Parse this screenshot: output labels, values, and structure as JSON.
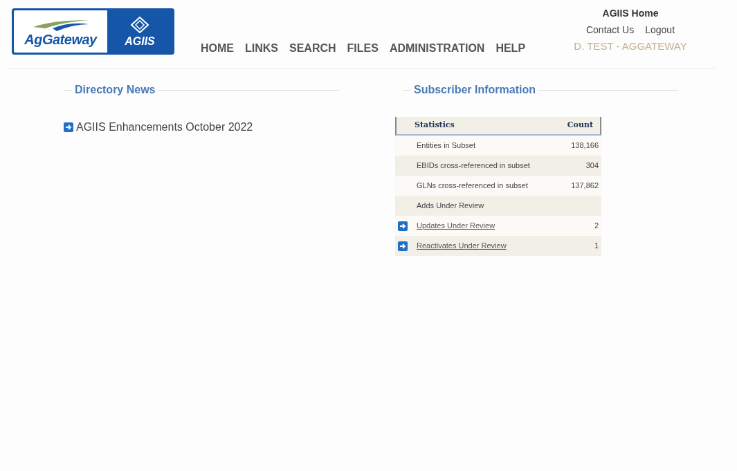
{
  "logo": {
    "left_text": "AgGateway",
    "right_text": "AGIIS"
  },
  "nav": [
    "HOME",
    "LINKS",
    "SEARCH",
    "FILES",
    "ADMINISTRATION",
    "HELP"
  ],
  "user_panel": {
    "title": "AGIIS Home",
    "links": [
      "Contact Us",
      "Logout"
    ],
    "user": "D. TEST - AGGATEWAY"
  },
  "directory_news": {
    "title": "Directory News",
    "items": [
      "AGIIS Enhancements October 2022"
    ]
  },
  "subscriber_information": {
    "title": "Subscriber Information",
    "table": {
      "columns": [
        "Statistics",
        "Count"
      ],
      "rows": [
        {
          "kind": "plain",
          "label": "Entities in Subset",
          "count": "138,166"
        },
        {
          "kind": "plain",
          "label": "EBIDs cross-referenced in subset",
          "count": "304"
        },
        {
          "kind": "plain",
          "label": "GLNs cross-referenced in subset",
          "count": "137,862"
        },
        {
          "kind": "plain",
          "label": "Adds Under Review"
        },
        {
          "kind": "link",
          "label": "Updates Under Review",
          "count": "2"
        },
        {
          "kind": "link",
          "label": "Reactivates Under Review",
          "count": "1"
        }
      ]
    }
  }
}
